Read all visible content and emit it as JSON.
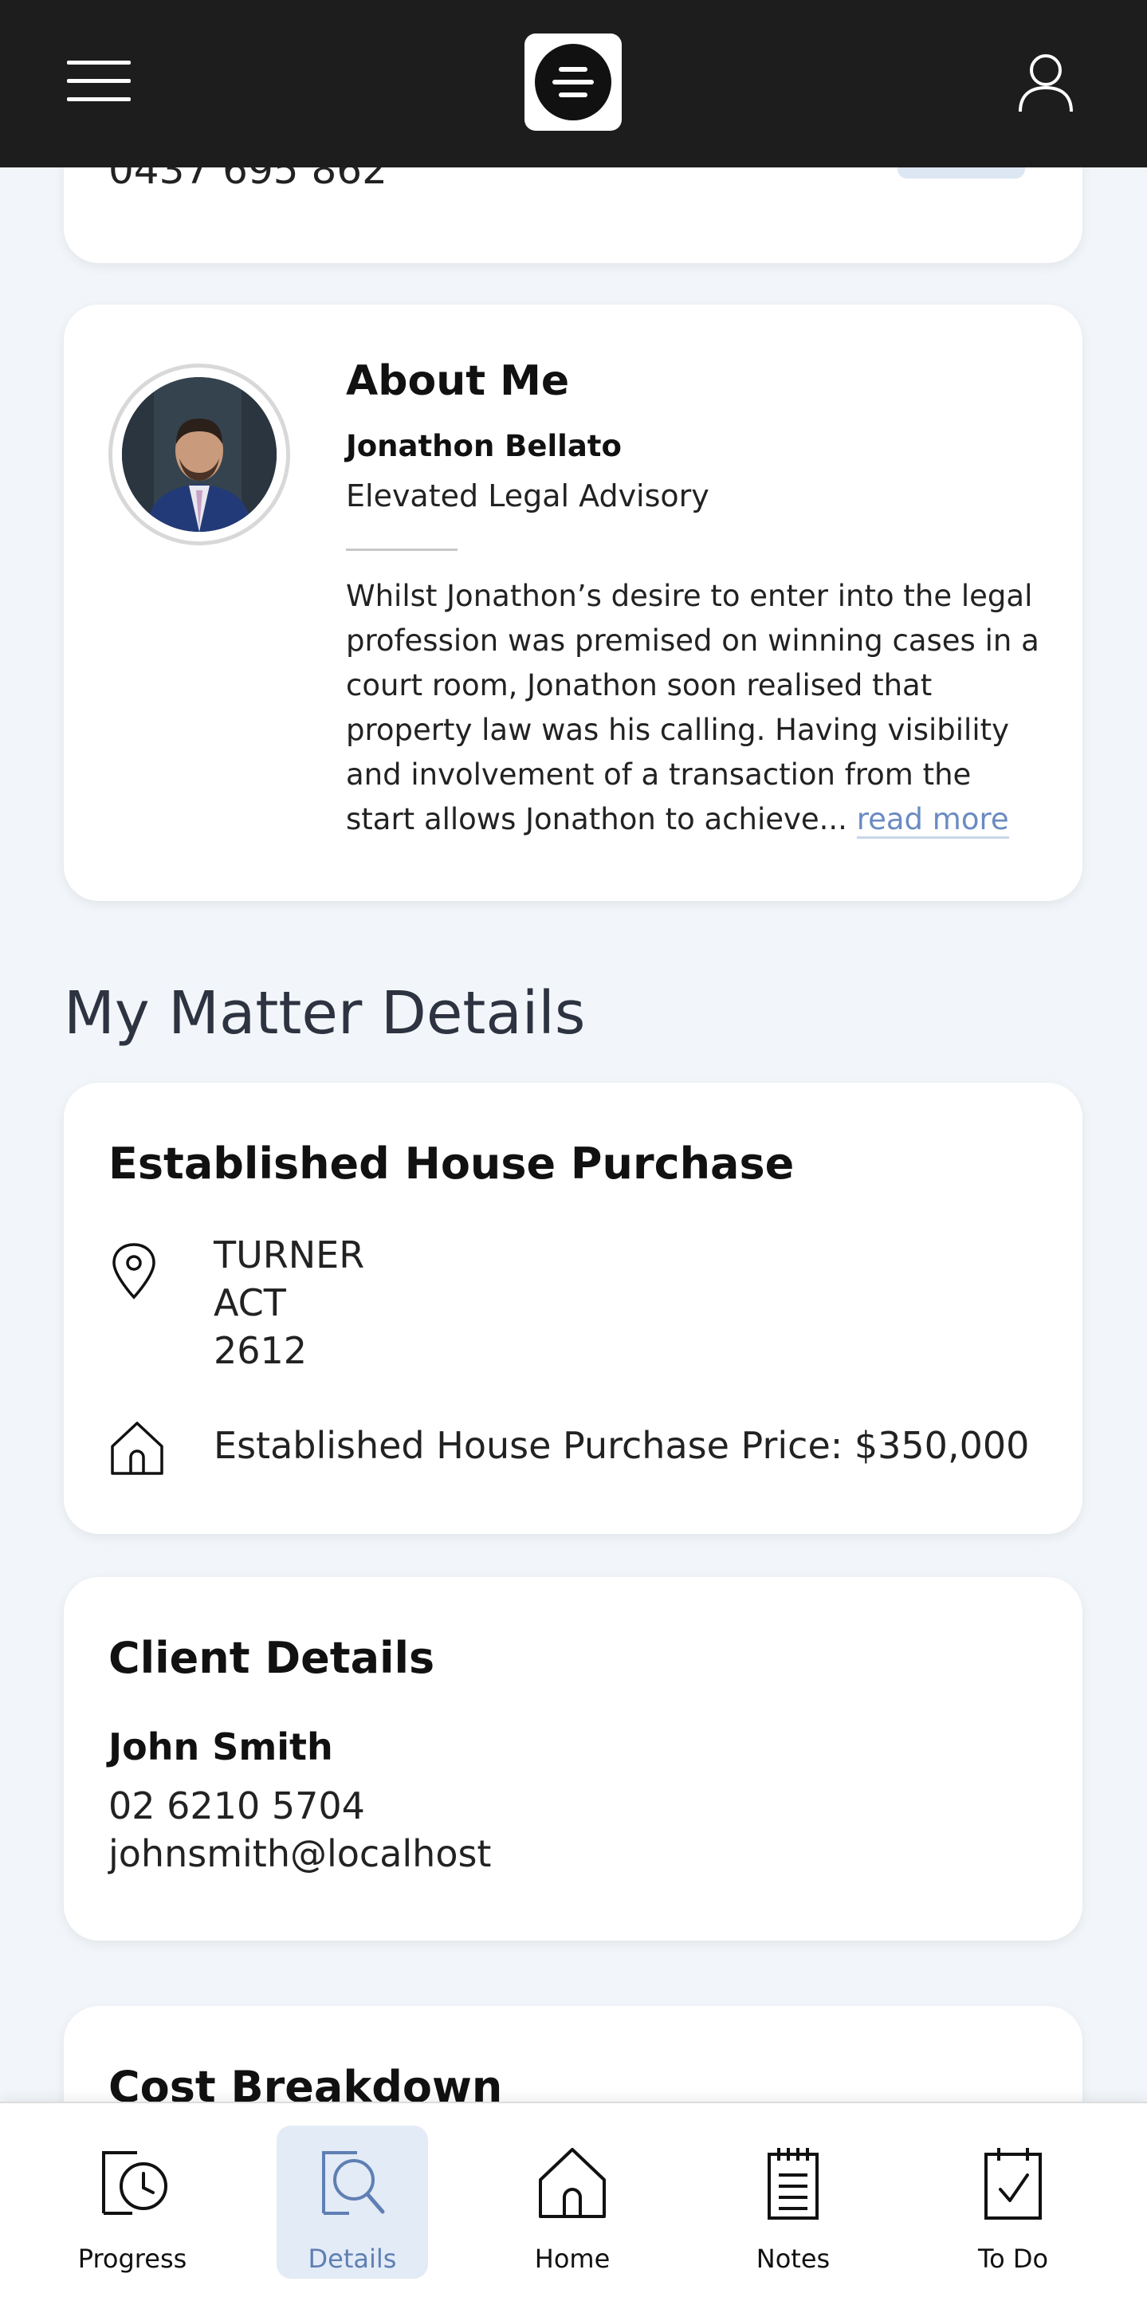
{
  "contact_card": {
    "phone_partial": "0437 695 862"
  },
  "about": {
    "title": "About Me",
    "name": "Jonathon Bellato",
    "firm": "Elevated Legal Advisory",
    "bio": "Whilst Jonathon’s desire to enter into the legal profession was premised on winning cases in a court room, Jonathon soon realised that property law was his calling. Having visibility and involvement of a transaction from the start allows Jonathon to achieve...",
    "read_more": "read more"
  },
  "section_title": "My Matter Details",
  "matter": {
    "title": "Established House Purchase",
    "suburb": "TURNER",
    "state": "ACT",
    "postcode": "2612",
    "price_text": "Established House Purchase Price: $350,000"
  },
  "client": {
    "title": "Client Details",
    "name": "John Smith",
    "phone": "02 6210 5704",
    "email": "johnsmith@localhost"
  },
  "cost": {
    "title": "Cost Breakdown"
  },
  "nav": {
    "items": [
      {
        "label": "Progress",
        "icon": "progress-icon",
        "active": false
      },
      {
        "label": "Details",
        "icon": "details-icon",
        "active": true
      },
      {
        "label": "Home",
        "icon": "home-icon",
        "active": false
      },
      {
        "label": "Notes",
        "icon": "notes-icon",
        "active": false
      },
      {
        "label": "To Do",
        "icon": "todo-icon",
        "active": false
      }
    ]
  },
  "colors": {
    "header_bg": "#1d1d1d",
    "page_bg": "#f2f6fa",
    "accent": "#5f7fb4",
    "active_nav_bg": "#e3ebf6"
  }
}
